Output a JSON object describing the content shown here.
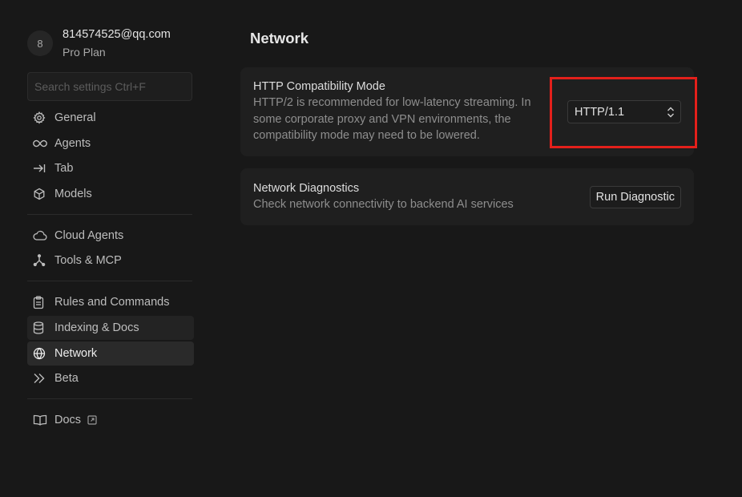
{
  "profile": {
    "avatar_letter": "8",
    "email": "814574525@qq.com",
    "plan": "Pro Plan"
  },
  "search": {
    "placeholder": "Search settings Ctrl+F"
  },
  "sidebar": {
    "groups": [
      [
        {
          "label": "General",
          "icon": "gear-icon"
        },
        {
          "label": "Agents",
          "icon": "infinity-icon"
        },
        {
          "label": "Tab",
          "icon": "tab-arrow-icon"
        },
        {
          "label": "Models",
          "icon": "cube-icon"
        }
      ],
      [
        {
          "label": "Cloud Agents",
          "icon": "cloud-icon"
        },
        {
          "label": "Tools & MCP",
          "icon": "tools-network-icon"
        }
      ],
      [
        {
          "label": "Rules and Commands",
          "icon": "clipboard-icon"
        },
        {
          "label": "Indexing & Docs",
          "icon": "database-icon"
        },
        {
          "label": "Network",
          "icon": "globe-icon"
        },
        {
          "label": "Beta",
          "icon": "double-chevron-icon"
        }
      ],
      [
        {
          "label": "Docs",
          "icon": "book-icon"
        }
      ]
    ],
    "active": "Network"
  },
  "main": {
    "title": "Network",
    "http_mode": {
      "title": "HTTP Compatibility Mode",
      "description": "HTTP/2 is recommended for low-latency streaming. In some corporate proxy and VPN environments, the compatibility mode may need to be lowered.",
      "selected": "HTTP/1.1"
    },
    "diagnostics": {
      "title": "Network Diagnostics",
      "description": "Check network connectivity to backend AI services",
      "button_label": "Run Diagnostic"
    }
  },
  "colors": {
    "background": "#181818",
    "card": "#1f1f1f",
    "active_item": "#2a2a2a",
    "highlight": "#e3201b"
  }
}
